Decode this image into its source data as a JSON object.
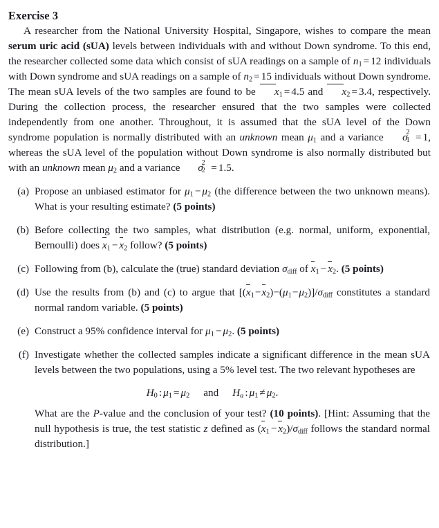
{
  "document": {
    "exercise_title": "Exercise 3",
    "intro": {
      "seg1": "A researcher from the National University Hospital, Singapore, wishes to compare the mean ",
      "bold1": "serum uric acid (sUA)",
      "seg2": " levels between individuals with and without Down syndrome. To this end, the researcher collected some data which consist of sUA readings on a sample of ",
      "n1_var": "n",
      "n1_sub": "1",
      "n1_eq": "=",
      "n1_val": "12",
      "seg3": " individuals with Down syndrome and sUA readings on a sample of ",
      "n2_var": "n",
      "n2_sub": "2",
      "n2_eq": "=",
      "n2_val": "15",
      "seg4": " individuals without Down syndrome. The mean sUA levels of the two samples are found to be ",
      "xbar1": "x",
      "xbar1_sub": "1",
      "xbar1_eq": "=",
      "xbar1_val": "4.5",
      "seg5": " and ",
      "xbar2": "x",
      "xbar2_sub": "2",
      "xbar2_eq": "=",
      "xbar2_val": "3.4",
      "seg6": ", respectively. During the collection process, the researcher ensured that the two samples were collected independently from one another. Throughout, it is assumed that the sUA level of the Down syndrome population is normally distributed with an ",
      "italic1": "unknown",
      "seg7": " mean ",
      "mu1": "μ",
      "mu1_sub": "1",
      "seg8": " and a variance ",
      "sigma1": "σ",
      "sigma1_pow": "2",
      "sigma1_sub": "1",
      "sigma1_eq": "=",
      "sigma1_val": "1",
      "seg9": ", whereas the sUA level of the population without Down syndrome is also normally distributed but with an ",
      "italic2": "unknown",
      "seg10": " mean ",
      "mu2": "μ",
      "mu2_sub": "2",
      "seg11": " and a variance ",
      "sigma2": "σ",
      "sigma2_pow": "2",
      "sigma2_sub": "2",
      "sigma2_eq": "=",
      "sigma2_val": "1.5",
      "seg12": "."
    },
    "items": [
      {
        "label": "(a)",
        "points": "(5 points)",
        "text_a": "Propose an unbiased estimator for ",
        "mu1": "μ",
        "mu1_sub": "1",
        "minus": "−",
        "mu2": "μ",
        "mu2_sub": "2",
        "text_b": " (the difference between the two unknown means). What is your resulting estimate? "
      },
      {
        "label": "(b)",
        "points": "(5 points)",
        "text_a": "Before collecting the two samples, what distribution (e.g. normal, uniform, exponential, Bernoulli) does ",
        "xbar1": "x",
        "xbar1_sub": "1",
        "minus": "−",
        "xbar2": "x",
        "xbar2_sub": "2",
        "text_b": " follow? "
      },
      {
        "label": "(c)",
        "points": "(5 points)",
        "text_a": "Following from (b), calculate the (true) standard deviation ",
        "sigma": "σ",
        "sigma_sub": "diff",
        "text_b": " of ",
        "xbar1": "x",
        "xbar1_sub": "1",
        "minus": "−",
        "xbar2": "x",
        "xbar2_sub": "2",
        "text_c": ". "
      },
      {
        "label": "(d)",
        "points": "(5 points)",
        "text_a": "Use the results from (b) and (c) to argue that ",
        "expr_open": "[(",
        "xbar1": "x",
        "xbar1_sub": "1",
        "minus1": "−",
        "xbar2": "x",
        "xbar2_sub": "2",
        "expr_mid": ")−(",
        "mu1": "μ",
        "mu1_sub": "1",
        "minus2": "−",
        "mu2": "μ",
        "mu2_sub": "2",
        "expr_close": ")]/",
        "sigma": "σ",
        "sigma_sub": "diff",
        "text_b": " constitutes a standard normal random variable. "
      },
      {
        "label": "(e)",
        "points": "(5 points)",
        "text_a": "Construct a 95% confidence interval for ",
        "mu1": "μ",
        "mu1_sub": "1",
        "minus": "−",
        "mu2": "μ",
        "mu2_sub": "2",
        "text_b": ". "
      },
      {
        "label": "(f)",
        "points": "(10 points)",
        "text_a": "Investigate whether the collected samples indicate a significant difference in the mean sUA levels between the two populations, using a 5% level test. The two relevant hypotheses are",
        "hypotheses": {
          "h0_name": "H",
          "h0_sub": "0",
          "h0_colon": ":",
          "h0_mu1": "μ",
          "h0_mu1_sub": "1",
          "h0_rel": "=",
          "h0_mu2": "μ",
          "h0_mu2_sub": "2",
          "conj": "and",
          "ha_name": "H",
          "ha_sub": "a",
          "ha_colon": ":",
          "ha_mu1": "μ",
          "ha_mu1_sub": "1",
          "ha_rel": "≠",
          "ha_mu2": "μ",
          "ha_mu2_sub": "2",
          "period": "."
        },
        "tail_a": "What are the ",
        "tail_pvar": "P",
        "tail_b": "-value and the conclusion of your test? ",
        "tail_c": ". [Hint: Assuming that the null hypothesis is true, the test statistic ",
        "tail_zvar": "z",
        "tail_d": " defined as (",
        "tail_xbar1": "x",
        "tail_xbar1_sub": "1",
        "tail_minus": "−",
        "tail_xbar2": "x",
        "tail_xbar2_sub": "2",
        "tail_e": ")/",
        "tail_sigma": "σ",
        "tail_sigma_sub": "diff",
        "tail_f": " follows the standard normal distribution.]"
      }
    ]
  }
}
